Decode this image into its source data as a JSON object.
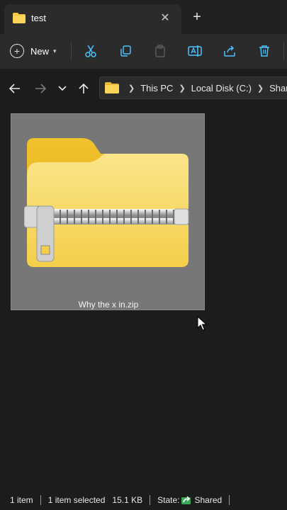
{
  "tab": {
    "title": "test",
    "close_icon": "close-icon",
    "new_tab_icon": "plus-icon"
  },
  "toolbar": {
    "new_label": "New",
    "icons": [
      "cut-icon",
      "copy-icon",
      "paste-icon",
      "rename-icon",
      "share-icon",
      "delete-icon"
    ]
  },
  "nav": {
    "icons": [
      "back-arrow-icon",
      "forward-arrow-icon",
      "recent-chevron-icon",
      "up-arrow-icon"
    ]
  },
  "address": {
    "crumbs": [
      "This PC",
      "Local Disk (C:)",
      "Shared"
    ]
  },
  "files": [
    {
      "name": "Why the x in.zip",
      "type": "zip-folder"
    }
  ],
  "status": {
    "item_count": "1 item",
    "selected": "1 item selected",
    "size": "15.1 KB",
    "state_label": "State:",
    "state_value": "Shared"
  },
  "colors": {
    "folder": "#f5c842",
    "accent": "#4cc2ff",
    "shared": "#3ca85a",
    "background": "#1c1c1c"
  }
}
